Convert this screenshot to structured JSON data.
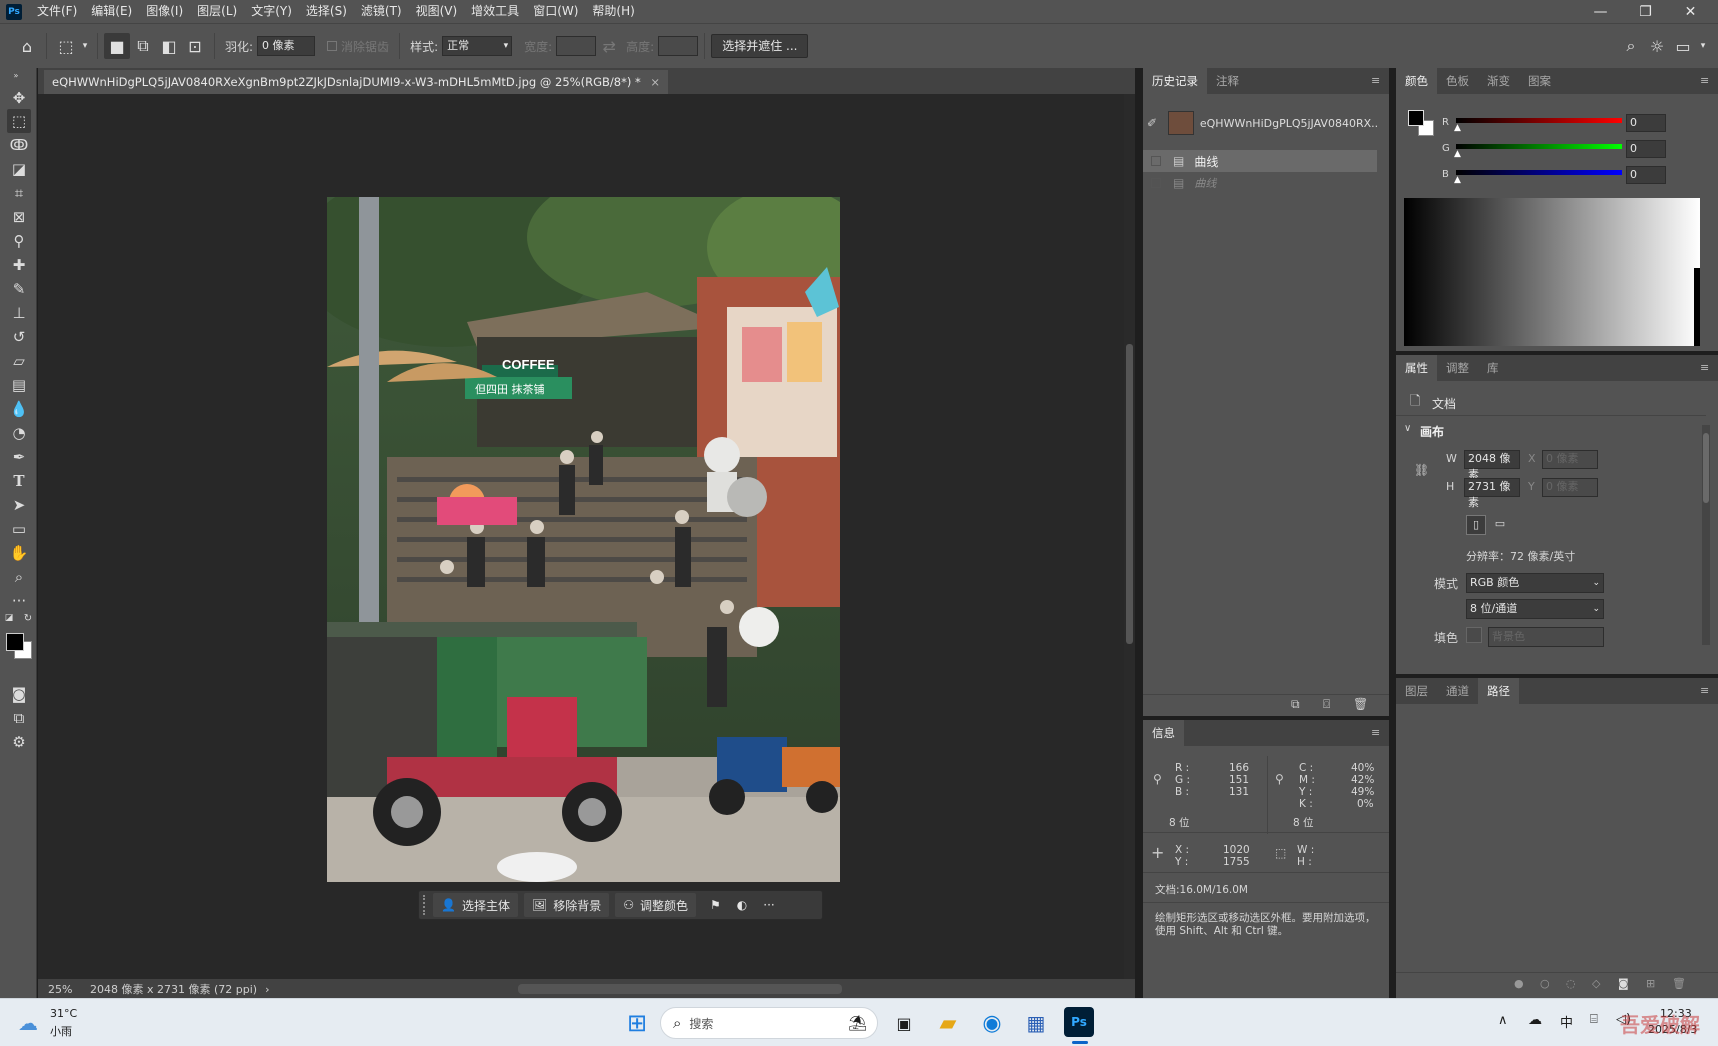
{
  "menu": {
    "items": [
      "文件(F)",
      "编辑(E)",
      "图像(I)",
      "图层(L)",
      "文字(Y)",
      "选择(S)",
      "滤镜(T)",
      "视图(V)",
      "增效工具",
      "窗口(W)",
      "帮助(H)"
    ],
    "logo": "Ps"
  },
  "options": {
    "feather_label": "羽化:",
    "feather_value": "0 像素",
    "antialias_label": "消除锯齿",
    "style_label": "样式:",
    "style_value": "正常",
    "width_label": "宽度:",
    "height_label": "高度:",
    "select_mask_button": "选择并遮住 ..."
  },
  "document": {
    "tab_title": "eQHWWnHiDgPLQ5jJAV0840RXeXgnBm9pt2ZJkJDsnlajDUMI9-x-W3-mDHL5mMtD.jpg @ 25%(RGB/8*) *",
    "close_glyph": "×",
    "zoom": "25%",
    "size_info": "2048 像素 x 2731 像素 (72 ppi)",
    "photo_sign_text": "COFFEE",
    "photo_sign_cn": "但四田 抹茶铺"
  },
  "context_bar": {
    "select_subject": "选择主体",
    "remove_bg": "移除背景",
    "adjust_color": "调整颜色"
  },
  "history": {
    "tabs": [
      "历史记录",
      "注释"
    ],
    "snapshot_name": "eQHWWnHiDgPLQ5jJAV0840RX...",
    "items": [
      "曲线",
      "曲线"
    ]
  },
  "color": {
    "tabs": [
      "颜色",
      "色板",
      "渐变",
      "图案"
    ],
    "r_label": "R",
    "g_label": "G",
    "b_label": "B",
    "r": "0",
    "g": "0",
    "b": "0"
  },
  "properties": {
    "tabs": [
      "属性",
      "调整",
      "库"
    ],
    "doc_label": "文档",
    "canvas_label": "画布",
    "w_label": "W",
    "h_label": "H",
    "x_label": "X",
    "y_label": "Y",
    "w_value": "2048 像素",
    "h_value": "2731 像素",
    "x_placeholder": "0 像素",
    "y_placeholder": "0 像素",
    "resolution": "分辨率：72 像素/英寸",
    "mode_label": "模式",
    "mode_value": "RGB 颜色",
    "depth_value": "8 位/通道",
    "fill_label": "填色",
    "fill_value": "背景色"
  },
  "info": {
    "tab": "信息",
    "r_label": "R :",
    "g_label": "G :",
    "b_label": "B :",
    "r": "166",
    "g": "151",
    "b": "131",
    "bits1": "8 位",
    "c_label": "C :",
    "m_label": "M :",
    "y_label": "Y :",
    "k_label": "K :",
    "c": "40%",
    "m": "42%",
    "y": "49%",
    "k": "0%",
    "bits2": "8 位",
    "x_label": "X :",
    "y2_label": "Y :",
    "x": "1020",
    "y2": "1755",
    "w_label": "W :",
    "h_label": "H :",
    "doc": "文档:16.0M/16.0M",
    "hint": "绘制矩形选区或移动选区外框。要用附加选项，使用 Shift、Alt 和 Ctrl 键。"
  },
  "layers": {
    "tabs": [
      "图层",
      "通道",
      "路径"
    ]
  },
  "taskbar": {
    "weather_temp": "31°C",
    "weather_desc": "小雨",
    "search_placeholder": "搜索",
    "ime": "中",
    "time": "12:33",
    "date": "2025/8/3",
    "watermark": "吾爱破解"
  }
}
